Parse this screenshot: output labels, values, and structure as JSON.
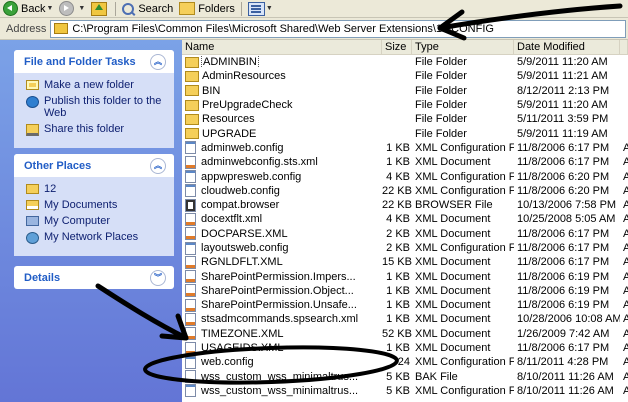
{
  "toolbar": {
    "back_label": "Back",
    "search_label": "Search",
    "folders_label": "Folders"
  },
  "address": {
    "label": "Address",
    "path": "C:\\Program Files\\Common Files\\Microsoft Shared\\Web Server Extensions\\12\\CONFIG"
  },
  "file_tasks": {
    "title": "File and Folder Tasks",
    "items": [
      {
        "label": "Make a new folder",
        "icon": "new-folder-icon"
      },
      {
        "label": "Publish this folder to the Web",
        "icon": "publish-web-icon"
      },
      {
        "label": "Share this folder",
        "icon": "share-folder-icon"
      }
    ]
  },
  "other_places": {
    "title": "Other Places",
    "items": [
      {
        "label": "12",
        "icon": "folder-icon"
      },
      {
        "label": "My Documents",
        "icon": "my-documents-icon"
      },
      {
        "label": "My Computer",
        "icon": "my-computer-icon"
      },
      {
        "label": "My Network Places",
        "icon": "network-places-icon"
      }
    ]
  },
  "details": {
    "title": "Details"
  },
  "columns": {
    "name": "Name",
    "size": "Size",
    "type": "Type",
    "date": "Date Modified"
  },
  "files": [
    {
      "name": "ADMINBIN",
      "size": "",
      "type": "File Folder",
      "date": "5/9/2011 11:20 AM",
      "attr": "",
      "icon": "folder"
    },
    {
      "name": "AdminResources",
      "size": "",
      "type": "File Folder",
      "date": "5/9/2011 11:21 AM",
      "attr": "",
      "icon": "folder"
    },
    {
      "name": "BIN",
      "size": "",
      "type": "File Folder",
      "date": "8/12/2011 2:13 PM",
      "attr": "",
      "icon": "folder"
    },
    {
      "name": "PreUpgradeCheck",
      "size": "",
      "type": "File Folder",
      "date": "5/9/2011 11:20 AM",
      "attr": "",
      "icon": "folder"
    },
    {
      "name": "Resources",
      "size": "",
      "type": "File Folder",
      "date": "5/11/2011 3:59 PM",
      "attr": "",
      "icon": "folder"
    },
    {
      "name": "UPGRADE",
      "size": "",
      "type": "File Folder",
      "date": "5/9/2011 11:19 AM",
      "attr": "",
      "icon": "folder"
    },
    {
      "name": "adminweb.config",
      "size": "1 KB",
      "type": "XML Configuration File",
      "date": "11/8/2006 6:17 PM",
      "attr": "A",
      "icon": "config"
    },
    {
      "name": "adminwebconfig.sts.xml",
      "size": "1 KB",
      "type": "XML Document",
      "date": "11/8/2006 6:17 PM",
      "attr": "A",
      "icon": "xml"
    },
    {
      "name": "appwpresweb.config",
      "size": "4 KB",
      "type": "XML Configuration File",
      "date": "11/8/2006 6:20 PM",
      "attr": "A",
      "icon": "config"
    },
    {
      "name": "cloudweb.config",
      "size": "22 KB",
      "type": "XML Configuration File",
      "date": "11/8/2006 6:20 PM",
      "attr": "A",
      "icon": "config"
    },
    {
      "name": "compat.browser",
      "size": "22 KB",
      "type": "BROWSER File",
      "date": "10/13/2006 7:58 PM",
      "attr": "A",
      "icon": "browser"
    },
    {
      "name": "docextflt.xml",
      "size": "4 KB",
      "type": "XML Document",
      "date": "10/25/2008 5:05 AM",
      "attr": "A",
      "icon": "xml"
    },
    {
      "name": "DOCPARSE.XML",
      "size": "2 KB",
      "type": "XML Document",
      "date": "11/8/2006 6:17 PM",
      "attr": "A",
      "icon": "xml"
    },
    {
      "name": "layoutsweb.config",
      "size": "2 KB",
      "type": "XML Configuration File",
      "date": "11/8/2006 6:17 PM",
      "attr": "A",
      "icon": "config"
    },
    {
      "name": "RGNLDFLT.XML",
      "size": "15 KB",
      "type": "XML Document",
      "date": "11/8/2006 6:17 PM",
      "attr": "A",
      "icon": "xml"
    },
    {
      "name": "SharePointPermission.Impers...",
      "size": "1 KB",
      "type": "XML Document",
      "date": "11/8/2006 6:19 PM",
      "attr": "A",
      "icon": "xml"
    },
    {
      "name": "SharePointPermission.Object...",
      "size": "1 KB",
      "type": "XML Document",
      "date": "11/8/2006 6:19 PM",
      "attr": "A",
      "icon": "xml"
    },
    {
      "name": "SharePointPermission.Unsafe...",
      "size": "1 KB",
      "type": "XML Document",
      "date": "11/8/2006 6:19 PM",
      "attr": "A",
      "icon": "xml"
    },
    {
      "name": "stsadmcommands.spsearch.xml",
      "size": "1 KB",
      "type": "XML Document",
      "date": "10/28/2006 10:08 AM",
      "attr": "A",
      "icon": "xml"
    },
    {
      "name": "TIMEZONE.XML",
      "size": "52 KB",
      "type": "XML Document",
      "date": "1/26/2009 7:42 AM",
      "attr": "A",
      "icon": "xml"
    },
    {
      "name": "USAGEIDS.XML",
      "size": "1 KB",
      "type": "XML Document",
      "date": "11/8/2006 6:17 PM",
      "attr": "A",
      "icon": "xml"
    },
    {
      "name": "web.config",
      "size": "24",
      "type": "XML Configuration File",
      "date": "8/11/2011 4:28 PM",
      "attr": "A",
      "icon": "config"
    },
    {
      "name": "wss_custom_wss_minimaltrus...",
      "size": "5 KB",
      "type": "BAK File",
      "date": "8/10/2011 11:26 AM",
      "attr": "A",
      "icon": "bak"
    },
    {
      "name": "wss_custom_wss_minimaltrus...",
      "size": "5 KB",
      "type": "XML Configuration File",
      "date": "8/10/2011 11:26 AM",
      "attr": "A",
      "icon": "config"
    }
  ]
}
